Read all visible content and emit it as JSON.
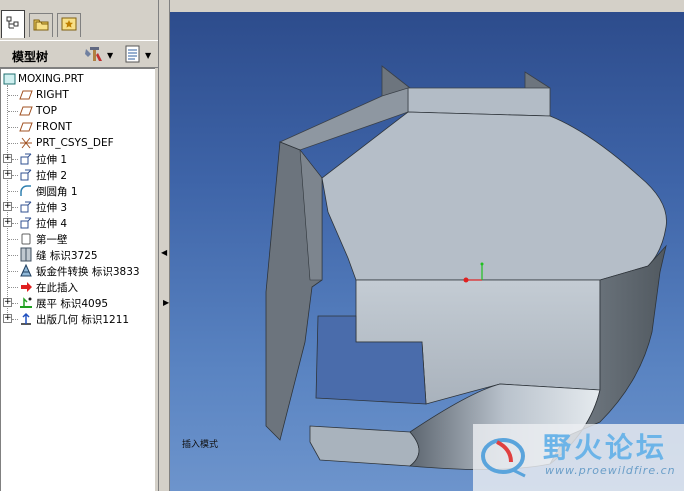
{
  "tabs": [
    {
      "name": "model-tree-tab",
      "icon": "model-tree-icon",
      "active": true
    },
    {
      "name": "folder-browser-tab",
      "icon": "folder-icon",
      "active": false
    },
    {
      "name": "favorites-tab",
      "icon": "favorites-icon",
      "active": false
    }
  ],
  "header": {
    "title": "模型树",
    "tools_icon": "tools-icon",
    "settings_icon": "settings-icon"
  },
  "tree": {
    "items": [
      {
        "label": "MOXING.PRT",
        "icon": "part-icon",
        "expandable": false
      },
      {
        "label": "RIGHT",
        "icon": "datum-plane-icon",
        "expandable": false
      },
      {
        "label": "TOP",
        "icon": "datum-plane-icon",
        "expandable": false
      },
      {
        "label": "FRONT",
        "icon": "datum-plane-icon",
        "expandable": false
      },
      {
        "label": "PRT_CSYS_DEF",
        "icon": "coordinate-system-icon",
        "expandable": false
      },
      {
        "label": "拉伸 1",
        "icon": "extrude-icon",
        "expandable": true
      },
      {
        "label": "拉伸 2",
        "icon": "extrude-icon",
        "expandable": true
      },
      {
        "label": "倒圆角 1",
        "icon": "round-icon",
        "expandable": false
      },
      {
        "label": "拉伸 3",
        "icon": "extrude-icon",
        "expandable": true
      },
      {
        "label": "拉伸 4",
        "icon": "extrude-icon",
        "expandable": true
      },
      {
        "label": "第一壁",
        "icon": "first-wall-icon",
        "expandable": false
      },
      {
        "label": "缝 标识3725",
        "icon": "seam-icon",
        "expandable": false
      },
      {
        "label": "钣金件转换 标识3833",
        "icon": "sheetmetal-convert-icon",
        "expandable": false
      },
      {
        "label": "在此插入",
        "icon": "insert-here-arrow-icon",
        "expandable": false
      },
      {
        "label": "展平 标识4095",
        "icon": "unbend-icon",
        "expandable": true
      },
      {
        "label": "出版几何 标识1211",
        "icon": "publish-geometry-icon",
        "expandable": true
      }
    ]
  },
  "viewport": {
    "status_text": "插入模式",
    "background_top": "#2d4c8c",
    "background_bottom": "#6d94cc"
  },
  "watermark": {
    "title": "野火论坛",
    "url": "www.proewildfire.cn"
  }
}
